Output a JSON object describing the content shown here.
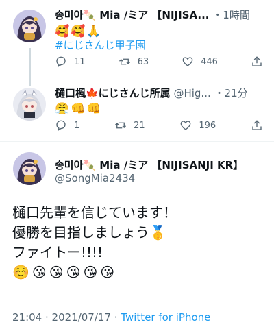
{
  "tweets": [
    {
      "display_name": "송미아🍡 Mia /ミア 【NIJISA...",
      "time": "・1時間",
      "emojis": "🥰🥰🙏",
      "hashtag": "#にじさんじ甲子園",
      "reply_count": "11",
      "retweet_count": "63",
      "like_count": "446"
    },
    {
      "display_name": "樋口楓🍁にじさんじ所属",
      "handle": "@Hig...",
      "time": "・21分",
      "emojis": "😤👊👊",
      "reply_count": "1",
      "retweet_count": "21",
      "like_count": "196"
    }
  ],
  "main_tweet": {
    "display_name": "송미아🍡 Mia /ミア 【NIJISANJI KR】",
    "handle": "@SongMia2434",
    "lines": [
      "樋口先輩を信じています！",
      "優勝を目指しましょう🥇",
      "ファイトー!!!!",
      "☺️😘😘😘😘😘"
    ],
    "timestamp": "21:04 · 2021/07/17 ·",
    "app": "Twitter for iPhone"
  },
  "icons": {
    "reply": "reply-icon",
    "retweet": "retweet-icon",
    "like": "heart-icon",
    "share": "share-icon"
  },
  "colors": {
    "link": "#1d9bf0",
    "muted": "#536471",
    "line": "#cfd9de"
  }
}
